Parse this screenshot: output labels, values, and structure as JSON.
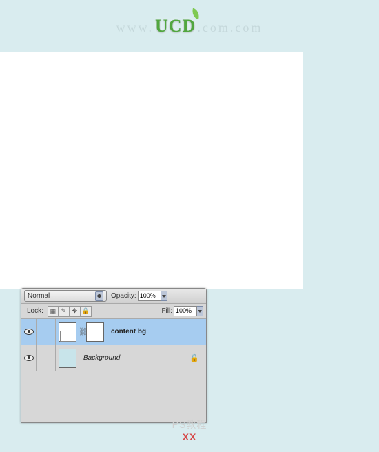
{
  "header": {
    "url_prefix": "www.",
    "brand": "UCD",
    "url_suffix": ".com.com"
  },
  "layersPanel": {
    "blendMode": "Normal",
    "opacityLabel": "Opacity:",
    "opacityValue": "100%",
    "lockLabel": "Lock:",
    "fillLabel": "Fill:",
    "fillValue": "100%",
    "layers": [
      {
        "name": "content bg",
        "selected": true,
        "hasMask": true
      },
      {
        "name": "Background",
        "selected": false,
        "locked": true
      }
    ]
  },
  "watermark": {
    "line1": "PS教程",
    "xx": "XX"
  }
}
